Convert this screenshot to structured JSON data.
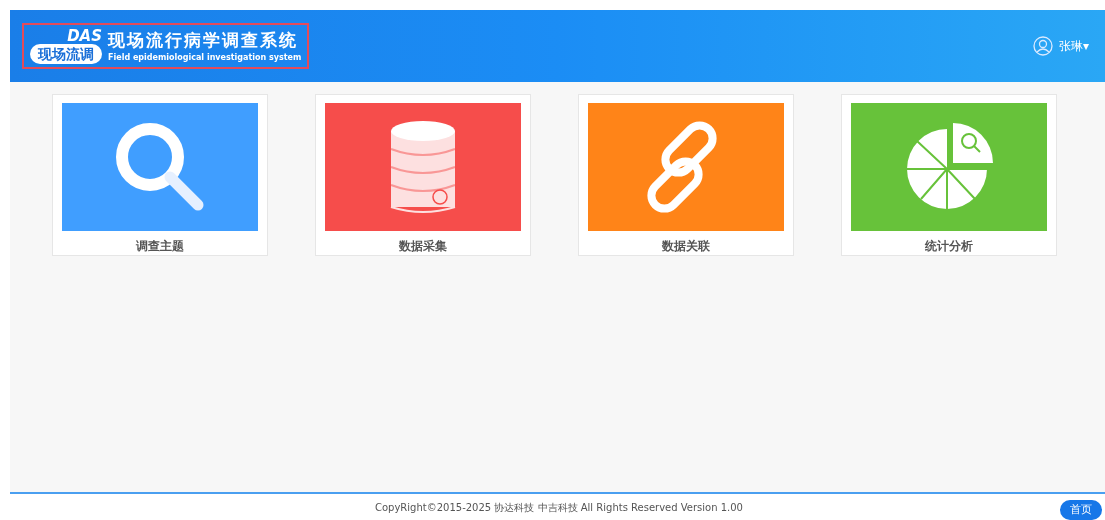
{
  "header": {
    "logo_mark": "DAS",
    "logo_badge": "现场流调",
    "title": "现场流行病学调查系统",
    "subtitle": "Field epidemiological investigation system",
    "user": "张琳▾"
  },
  "modules": [
    {
      "label": "调查主题",
      "kind": "search",
      "color": "#409eff"
    },
    {
      "label": "数据采集",
      "kind": "database",
      "color": "#f64d4b"
    },
    {
      "label": "数据关联",
      "kind": "link",
      "color": "#ff8418"
    },
    {
      "label": "统计分析",
      "kind": "pie",
      "color": "#67c23a"
    }
  ],
  "footer": {
    "copyright": "CopyRight©2015-2025 协达科技 中吉科技 All Rights Reserved Version 1.00",
    "home_button": "首页"
  }
}
